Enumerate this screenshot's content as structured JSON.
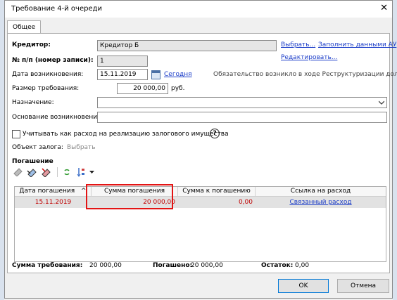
{
  "window": {
    "title": "Требование 4-й очереди",
    "close_symbol": "✕"
  },
  "tabs": [
    {
      "label": "Общее"
    }
  ],
  "creditor": {
    "label": "Кредитор:",
    "value": "Кредитор Б",
    "select_link": "Выбрать...",
    "fill_link": "Заполнить данными АУ",
    "edit_link": "Редактировать..."
  },
  "record_no": {
    "label": "№ п/п (номер записи):",
    "value": "1"
  },
  "origin_date": {
    "label": "Дата возникновения:",
    "value": "15.11.2019",
    "today_link": "Сегодня",
    "note": "Обязательство возникло в ходе Реструктуризации долгов"
  },
  "amount": {
    "label": "Размер требования:",
    "value": "20 000,00",
    "unit": "руб."
  },
  "purpose": {
    "label": "Назначение:",
    "value": ""
  },
  "basis": {
    "label": "Основание возникновения:",
    "value": ""
  },
  "pledge": {
    "checkbox_label": "Учитывать как расход на реализацию залогового имущества",
    "checked": false,
    "help": "?",
    "object_label": "Объект залога:",
    "object_link": "Выбрать"
  },
  "repayment": {
    "section_title": "Погашение",
    "columns": [
      "Дата погашения",
      "Сумма погашения",
      "Сумма к погашению",
      "Ссылка на расход"
    ],
    "sort_indicator": "^",
    "rows": [
      {
        "date": "15.11.2019",
        "paid": "20 000,00",
        "remaining": "0,00",
        "link": "Связанный расход"
      }
    ]
  },
  "summary": {
    "total_label": "Сумма требования:",
    "total_value": "20 000,00",
    "paid_label": "Погашено:",
    "paid_value": "20 000,00",
    "balance_label": "Остаток:",
    "balance_value": "0,00"
  },
  "buttons": {
    "ok": "OK",
    "cancel": "Отмена"
  },
  "colors": {
    "accent_link": "#1a3cc8",
    "date_red": "#c00000",
    "highlight_border": "#e31414"
  }
}
